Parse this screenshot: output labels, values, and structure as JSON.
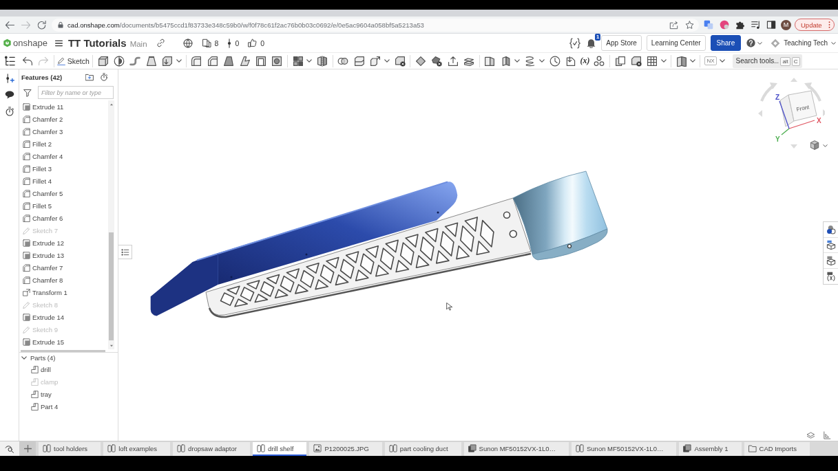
{
  "browser": {
    "url": "cad.onshape.com/documents/b5475ccd1f83733e348c59b0/w/f0f78c61f2ac76b0b03c0692/e/0e5ac9604a058bf5a5213a53",
    "profile": "M",
    "update_button": "Update"
  },
  "header": {
    "logo": "onshape",
    "document": "TT Tutorials",
    "workspace": "Main",
    "versions": "8",
    "branches": "0",
    "likes": "0",
    "notifications": "1",
    "buttons": [
      {
        "label": "App Store",
        "kind": "outline"
      },
      {
        "label": "Learning Center",
        "kind": "outline"
      },
      {
        "label": "Share",
        "kind": "primary"
      }
    ],
    "account": "Teaching Tech"
  },
  "toolbar": {
    "sketch": "Sketch",
    "variables": "(x)",
    "nx": "NX",
    "search": {
      "placeholder": "Search tools...",
      "shortcut": [
        "alt",
        "C"
      ]
    }
  },
  "feature_panel": {
    "title": "Features (42)",
    "filter": {
      "placeholder": "Filter by name or type"
    },
    "features": [
      {
        "name": "Extrude 11",
        "kind": "extrude",
        "hidden": false
      },
      {
        "name": "Chamfer 2",
        "kind": "chamfer",
        "hidden": false
      },
      {
        "name": "Chamfer 3",
        "kind": "chamfer",
        "hidden": false
      },
      {
        "name": "Fillet 2",
        "kind": "fillet",
        "hidden": false
      },
      {
        "name": "Chamfer 4",
        "kind": "chamfer",
        "hidden": false
      },
      {
        "name": "Fillet 3",
        "kind": "fillet",
        "hidden": false
      },
      {
        "name": "Fillet 4",
        "kind": "fillet",
        "hidden": false
      },
      {
        "name": "Chamfer 5",
        "kind": "chamfer",
        "hidden": false
      },
      {
        "name": "Fillet 5",
        "kind": "fillet",
        "hidden": false
      },
      {
        "name": "Chamfer 6",
        "kind": "chamfer",
        "hidden": false
      },
      {
        "name": "Sketch 7",
        "kind": "sketch",
        "hidden": true
      },
      {
        "name": "Extrude 12",
        "kind": "extrude",
        "hidden": false
      },
      {
        "name": "Extrude 13",
        "kind": "extrude",
        "hidden": false
      },
      {
        "name": "Chamfer 7",
        "kind": "chamfer",
        "hidden": false
      },
      {
        "name": "Chamfer 8",
        "kind": "chamfer",
        "hidden": false
      },
      {
        "name": "Transform 1",
        "kind": "transform",
        "hidden": false
      },
      {
        "name": "Sketch 8",
        "kind": "sketch",
        "hidden": true
      },
      {
        "name": "Extrude 14",
        "kind": "extrude",
        "hidden": false
      },
      {
        "name": "Sketch 9",
        "kind": "sketch",
        "hidden": true
      },
      {
        "name": "Extrude 15",
        "kind": "extrude",
        "hidden": false
      }
    ],
    "parts": {
      "title": "Parts (4)",
      "expanded": true,
      "items": [
        {
          "name": "drill",
          "hidden": false
        },
        {
          "name": "clamp",
          "hidden": true
        },
        {
          "name": "tray",
          "hidden": false
        },
        {
          "name": "Part 4",
          "hidden": false
        }
      ]
    }
  },
  "view_cube": {
    "face": "Front",
    "axes": [
      {
        "label": "X",
        "color": "#e05561"
      },
      {
        "label": "Y",
        "color": "#4cae4f"
      },
      {
        "label": "Z",
        "color": "#4b4fc9"
      }
    ]
  },
  "tabs": [
    {
      "label": "tool holders",
      "kind": "part_studio",
      "selected": false
    },
    {
      "label": "loft examples",
      "kind": "part_studio",
      "selected": false
    },
    {
      "label": "dropsaw adaptor",
      "kind": "part_studio",
      "selected": false
    },
    {
      "label": "drill shelf",
      "kind": "part_studio",
      "selected": true
    },
    {
      "label": "P1200025.JPG",
      "kind": "image",
      "selected": false
    },
    {
      "label": "part cooling duct",
      "kind": "part_studio",
      "selected": false
    },
    {
      "label": "Sunon MF50152VX-1L0…",
      "kind": "assembly",
      "selected": false
    },
    {
      "label": "Sunon MF50152VX-1L0…",
      "kind": "part_studio",
      "selected": false
    },
    {
      "label": "Assembly 1",
      "kind": "assembly",
      "selected": false
    },
    {
      "label": "CAD Imports",
      "kind": "folder",
      "selected": false
    }
  ]
}
